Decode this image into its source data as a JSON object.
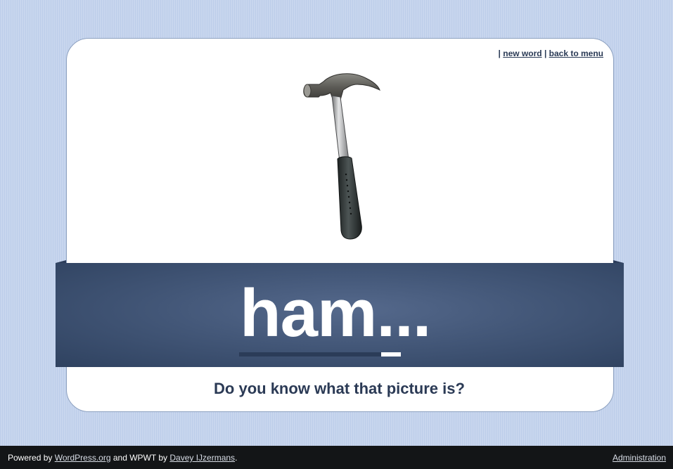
{
  "top_links": {
    "separator": "|",
    "new_word": "new word",
    "back_to_menu": "back to menu"
  },
  "picture": {
    "icon": "hammer-icon"
  },
  "word_display": {
    "text": "ham...",
    "progress": 0.88
  },
  "question": "Do you know what that picture is?",
  "footer": {
    "powered_by": "Powered by",
    "wordpress_link": "WordPress.org",
    "and_text": "and WPWT by",
    "author_link": "Davey IJzermans",
    "period": ".",
    "admin_link": "Administration"
  },
  "colors": {
    "background": "#c3d3ec",
    "band": "#435778",
    "footer": "#131517",
    "text_dark": "#2b3a55"
  }
}
